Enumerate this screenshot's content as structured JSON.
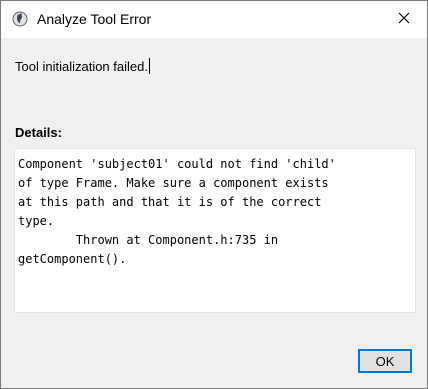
{
  "window": {
    "title": "Analyze Tool Error",
    "app_icon": "opensim-tool-icon",
    "close_icon": "close-icon"
  },
  "message": "Tool initialization failed.",
  "details": {
    "label": "Details:",
    "text": "Component 'subject01' could not find 'child'\nof type Frame. Make sure a component exists\nat this path and that it is of the correct\ntype.\n        Thrown at Component.h:735 in\ngetComponent()."
  },
  "buttons": {
    "ok_label": "OK"
  },
  "colors": {
    "accent": "#0078d7",
    "dialog_bg": "#f0f0f0"
  }
}
